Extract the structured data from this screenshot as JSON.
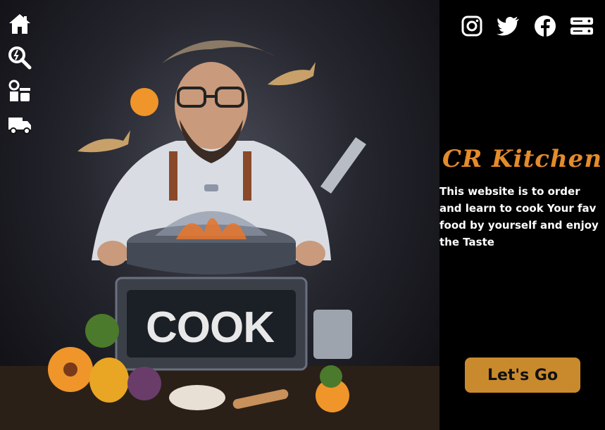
{
  "nav": {
    "items": [
      {
        "icon": "home-icon",
        "label": "Home"
      },
      {
        "icon": "search-icon",
        "label": "Search"
      },
      {
        "icon": "chef-kitchen-icon",
        "label": "Kitchen"
      },
      {
        "icon": "delivery-truck-icon",
        "label": "Delivery"
      }
    ]
  },
  "social": [
    "instagram-icon",
    "twitter-icon",
    "facebook-icon",
    "server-icon"
  ],
  "hero": {
    "cook_text": "COOK"
  },
  "brand": {
    "title": "CR Kitchen",
    "description": "This website is to order and learn to cook Your  fav food by yourself and enjoy the Taste"
  },
  "cta": {
    "label": "Let's Go"
  },
  "colors": {
    "accent": "#e48b2a",
    "button": "#c98a2e",
    "panel": "#000000"
  }
}
